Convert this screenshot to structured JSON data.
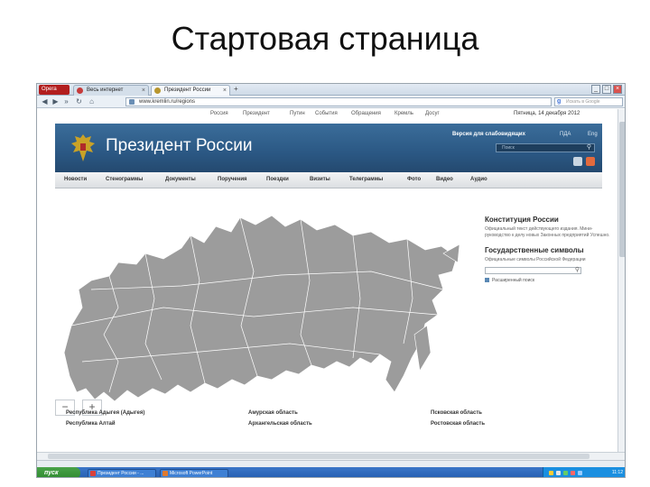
{
  "slide": {
    "title": "Стартовая страница"
  },
  "browser": {
    "menu_label": "Opera",
    "tabs": [
      {
        "label": "Весь интернет",
        "icon": "page-icon"
      },
      {
        "label": "Президент России",
        "icon": "eagle-icon"
      }
    ],
    "new_tab": "+",
    "address": "www.kremlin.ru/regions",
    "search_placeholder": "Искать в Google",
    "window_controls": [
      "_",
      "□",
      "×"
    ]
  },
  "site": {
    "top_links": [
      "Россия",
      "Президент",
      "Путин",
      "События",
      "Обращения",
      "Кремль",
      "Досуг"
    ],
    "date": "Пятница, 14 декабря 2012",
    "title": "Президент России",
    "accessibility_link": "Версия для слабовидящих",
    "lang_1": "ПДА",
    "lang_2": "Eng",
    "search_placeholder": "Поиск",
    "nav": [
      "Новости",
      "Стенограммы",
      "Документы",
      "Поручения",
      "Поездки",
      "Визиты",
      "Телеграммы",
      "Фото",
      "Видео",
      "Аудио"
    ],
    "zoom_out": "−",
    "zoom_in": "+",
    "sidebar": {
      "constitution_title": "Конституция России",
      "constitution_text": "Официальный текст действующего издания. Мини-руководство к делу новых Законных предприятий Успешно.",
      "symbols_title": "Государственные символы",
      "symbols_text": "Официальные символы Российской Федерации",
      "link": "Расширенный поиск"
    },
    "regions": [
      "Республика Адыгея (Адыгея)",
      "Амурская область",
      "Псковская область",
      "Республика Алтай",
      "Архангельская область",
      "Ростовская область"
    ]
  },
  "taskbar": {
    "start": "пуск",
    "tasks": [
      "Президент России - ...",
      "Microsoft PowerPoint"
    ],
    "clock": "11:12"
  }
}
